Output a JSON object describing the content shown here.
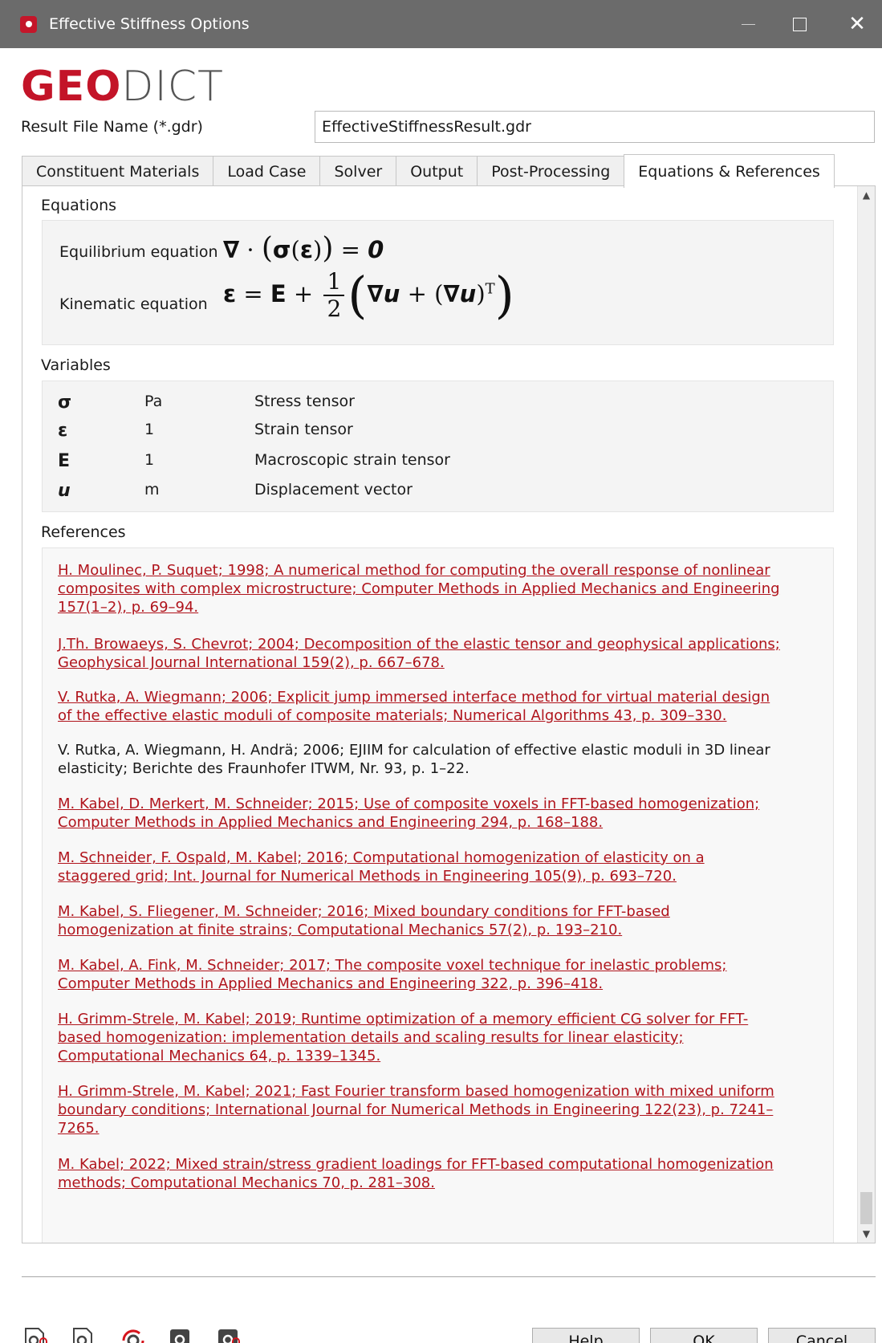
{
  "window": {
    "title": "Effective Stiffness Options",
    "close_glyph": "✕"
  },
  "brand": {
    "part1": "GEO",
    "part2": "DICT"
  },
  "result_file": {
    "label": "Result File Name (*.gdr)",
    "value": "EffectiveStiffnessResult.gdr"
  },
  "tabs": [
    {
      "label": "Constituent Materials"
    },
    {
      "label": "Load Case"
    },
    {
      "label": "Solver"
    },
    {
      "label": "Output"
    },
    {
      "label": "Post-Processing"
    },
    {
      "label": "Equations & References"
    }
  ],
  "equations": {
    "heading": "Equations",
    "equilibrium_label": "Equilibrium equation",
    "kinematic_label": "Kinematic equation"
  },
  "variables": {
    "heading": "Variables",
    "rows": [
      {
        "symbol": "σ",
        "unit": "Pa",
        "description": "Stress tensor"
      },
      {
        "symbol": "ε",
        "unit": "1",
        "description": "Strain tensor"
      },
      {
        "symbol": "E",
        "unit": "1",
        "description": "Macroscopic strain tensor"
      },
      {
        "symbol": "u",
        "unit": "m",
        "description": "Displacement vector"
      }
    ]
  },
  "references": {
    "heading": "References",
    "items": [
      {
        "text": "H. Moulinec, P. Suquet; 1998; A numerical method for computing the overall response of nonlinear composites with complex microstructure; Computer Methods in Applied Mechanics and Engineering 157(1–2), p. 69–94.",
        "link": true
      },
      {
        "text": "J.Th. Browaeys, S. Chevrot; 2004; Decomposition of the elastic tensor and geophysical applications; Geophysical Journal International 159(2), p. 667–678.",
        "link": true
      },
      {
        "text": "V. Rutka, A. Wiegmann; 2006; Explicit jump immersed interface method for virtual material design of the effective elastic moduli of composite materials; Numerical Algorithms 43, p. 309–330.",
        "link": true
      },
      {
        "text": "V. Rutka, A. Wiegmann, H. Andrä; 2006; EJIIM for calculation of effective elastic moduli in 3D linear elasticity; Berichte des Fraunhofer ITWM, Nr. 93, p. 1–22.",
        "link": false
      },
      {
        "text": "M. Kabel, D. Merkert, M. Schneider; 2015; Use of composite voxels in FFT-based homogenization; Computer Methods in Applied Mechanics and Engineering 294, p. 168–188.",
        "link": true
      },
      {
        "text": "M. Schneider, F. Ospald, M. Kabel; 2016; Computational homogenization of elasticity on a staggered grid; Int. Journal for Numerical Methods in Engineering 105(9), p. 693–720.",
        "link": true
      },
      {
        "text": "M. Kabel, S. Fliegener, M. Schneider; 2016; Mixed boundary conditions for FFT-based homogenization at finite strains; Computational Mechanics 57(2), p. 193–210.",
        "link": true
      },
      {
        "text": "M. Kabel, A. Fink, M. Schneider; 2017; The composite voxel technique for inelastic problems; Computer Methods in Applied Mechanics and Engineering 322, p. 396–418.",
        "link": true
      },
      {
        "text": "H. Grimm-Strele, M. Kabel; 2019; Runtime optimization of a memory efficient CG solver for FFT-based homogenization: implementation details and scaling results for linear elasticity; Computational Mechanics 64, p. 1339–1345.",
        "link": true
      },
      {
        "text": "H. Grimm-Strele, M. Kabel; 2021; Fast Fourier transform based homogenization with mixed uniform boundary conditions; International Journal for Numerical Methods in Engineering 122(23), p. 7241–7265.",
        "link": true
      },
      {
        "text": "M. Kabel; 2022; Mixed strain/stress gradient loadings for FFT-based computational homogenization methods; Computational Mechanics 70, p. 281–308.",
        "link": true
      }
    ]
  },
  "buttons": {
    "help": "Help",
    "ok": "OK",
    "cancel": "Cancel"
  },
  "colors": {
    "brand_red": "#c31428",
    "link_red": "#b0141c",
    "titlebar": "#6b6b6b"
  },
  "toolbar_icons": [
    "load-settings-locked-icon",
    "save-settings-icon",
    "reset-settings-icon",
    "edit-settings-icon",
    "lock-settings-icon"
  ]
}
